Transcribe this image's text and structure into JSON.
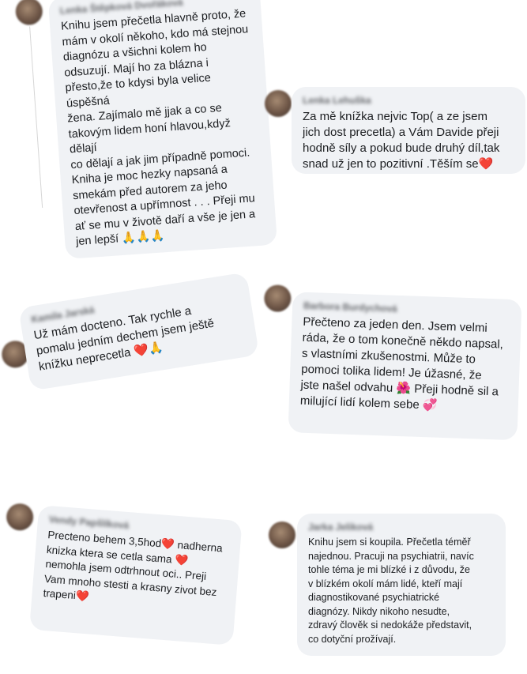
{
  "comments": [
    {
      "author": "Lenka Štěpková Dvořáková",
      "text": "Knihu jsem přečetla hlavně proto, že\nmám v okolí někoho, kdo má stejnou\ndiagnózu a všichni kolem ho\nodsuzují. Mají ho za blázna i\npřesto,že to kdysi byla velice úspěšná\nžena. Zajímalo mě jjak a co se\ntakovým lidem honí hlavou,když dělají\nco dělají a jak jim případně pomoci.\nKniha je moc hezky napsaná a\nsmekám před autorem za jeho\notevřenost a upřímnost . . . Přeji mu\nať se mu v životě daří a vše je jen a\njen lepší 🙏🙏🙏"
    },
    {
      "author": "Lenka Lehuška",
      "text": "Za mě knížka nejvic Top( a ze jsem\njich dost precetla) a Vám Davide přeji\nhodně síly a pokud bude druhý díl,tak\nsnad už jen to pozitivní .Těším se❤️"
    },
    {
      "author": "Kamila Jarská",
      "text": "Už mám docteno. Tak rychle a\npomalu jedním dechem jsem ještě\nknížku neprecetla ❤️🙏"
    },
    {
      "author": "Barbora Burdychová",
      "text": "Přečteno za jeden den. Jsem velmi\nráda, že o tom konečně někdo napsal,\ns vlastními zkušenostmi. Může to\npomoci tolika lidem!  Je úžasné, že\njste našel odvahu 🌺 Přeji hodně sil a\nmilující lidí kolem sebe 💞"
    },
    {
      "author": "Vendy Papšlíková",
      "text": "Precteno behem 3,5hod❤️ nadherna\nknizka ktera se cetla sama ❤️\nnemohla jsem odtrhnout oci.. Preji\nVam mnoho stesti a krasny zivot bez\ntrapeni❤️"
    },
    {
      "author": "Jarka Jeliková",
      "text": "Knihu jsem si koupila. Přečetla téměř\nnajednou. Pracuji na psychiatrii, navíc\ntohle téma je mi blízké i z důvodu, že\nv blízkém okolí mám lidé, kteří mají\ndiagnostikované psychiatrické\ndiagnózy. Nikdy nikoho nesudte,\nzdravý člověk si nedokáže představit,\nco dotyční prožívají."
    }
  ]
}
